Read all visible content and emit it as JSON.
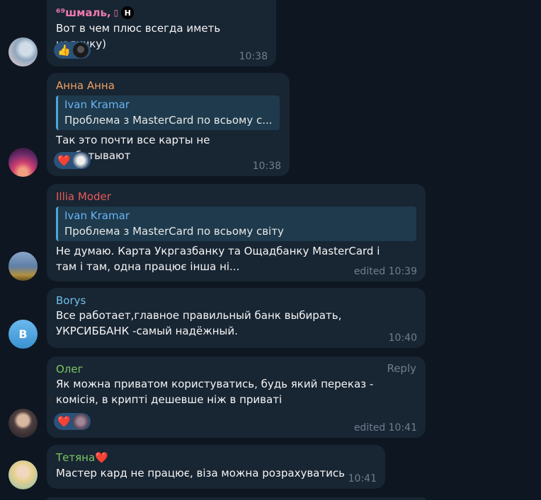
{
  "messages": [
    {
      "sender": "⁶⁹шмаль,",
      "sender_badges": [
        "▯",
        "H"
      ],
      "sender_color": "#ee7aae",
      "text": "Вот в чем плюс всегда иметь наличку)",
      "time": "10:38",
      "reaction_emoji": "👍"
    },
    {
      "sender": "Анна Анна",
      "sender_color": "#f0a060",
      "reply_name": "Ivan Kramar",
      "reply_text": "Проблема з MasterCard по всьому с...",
      "text": "Так это почти все карты не срабатывают",
      "time": "10:38",
      "reaction_emoji": "❤️"
    },
    {
      "sender": "Illia Moder",
      "sender_color": "#ea5a5a",
      "reply_name": "Ivan Kramar",
      "reply_text": "Проблема з MasterCard по всьому світу",
      "text": "Не думаю. Карта Укргазбанку та Ощадбанку MasterCard і там і там, одна працює інша ні...",
      "time": "edited 10:39"
    },
    {
      "sender": "Borys",
      "sender_color": "#6ec1ea",
      "avatar_letter": "B",
      "text": "Все работает,главное правильный банк выбирать, УКРСИББАНК -самый надёжный.",
      "time": "10:40"
    },
    {
      "sender": "Олег",
      "sender_color": "#7bc862",
      "reply_action": "Reply",
      "text": "Як можна приватом користуватись, будь який переказ - комісія, в крипті дешевше ніж в приваті",
      "time": "edited 10:41",
      "reaction_emoji": "❤️"
    },
    {
      "sender": "Тетяна❤️",
      "sender_color": "#7bc862",
      "text": "Мастер кард не працює, віза можна розрахуватись",
      "time": "10:41"
    }
  ],
  "colors": {
    "background": "#0e1621",
    "bubble": "#182533",
    "reply_bar": "#4fa5d8",
    "reaction_bg": "#2b5278",
    "time": "#6d7f8f",
    "borys_avatar": "#3fa0d8"
  }
}
